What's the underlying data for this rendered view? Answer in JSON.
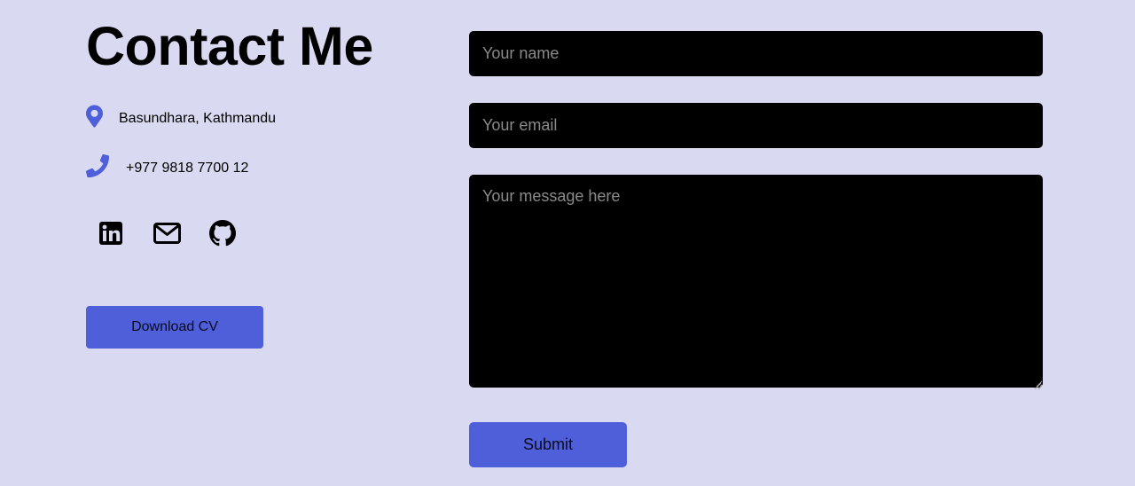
{
  "contact": {
    "title": "Contact Me",
    "address": {
      "icon": "map-pin-icon",
      "text": "Basundhara, Kathmandu"
    },
    "phone": {
      "icon": "phone-icon",
      "text": "+977 9818 7700 12"
    },
    "socials": [
      {
        "icon": "linkedin-icon"
      },
      {
        "icon": "mail-icon"
      },
      {
        "icon": "github-icon"
      }
    ],
    "download_cv_label": "Download CV"
  },
  "form": {
    "name_placeholder": "Your name",
    "name_value": "",
    "email_placeholder": "Your email",
    "email_value": "",
    "message_placeholder": "Your message here",
    "message_value": "",
    "submit_label": "Submit"
  },
  "colors": {
    "background": "#d9daf1",
    "accent": "#4f5fd9",
    "field_background": "#000000",
    "placeholder": "#8a8a8a"
  }
}
